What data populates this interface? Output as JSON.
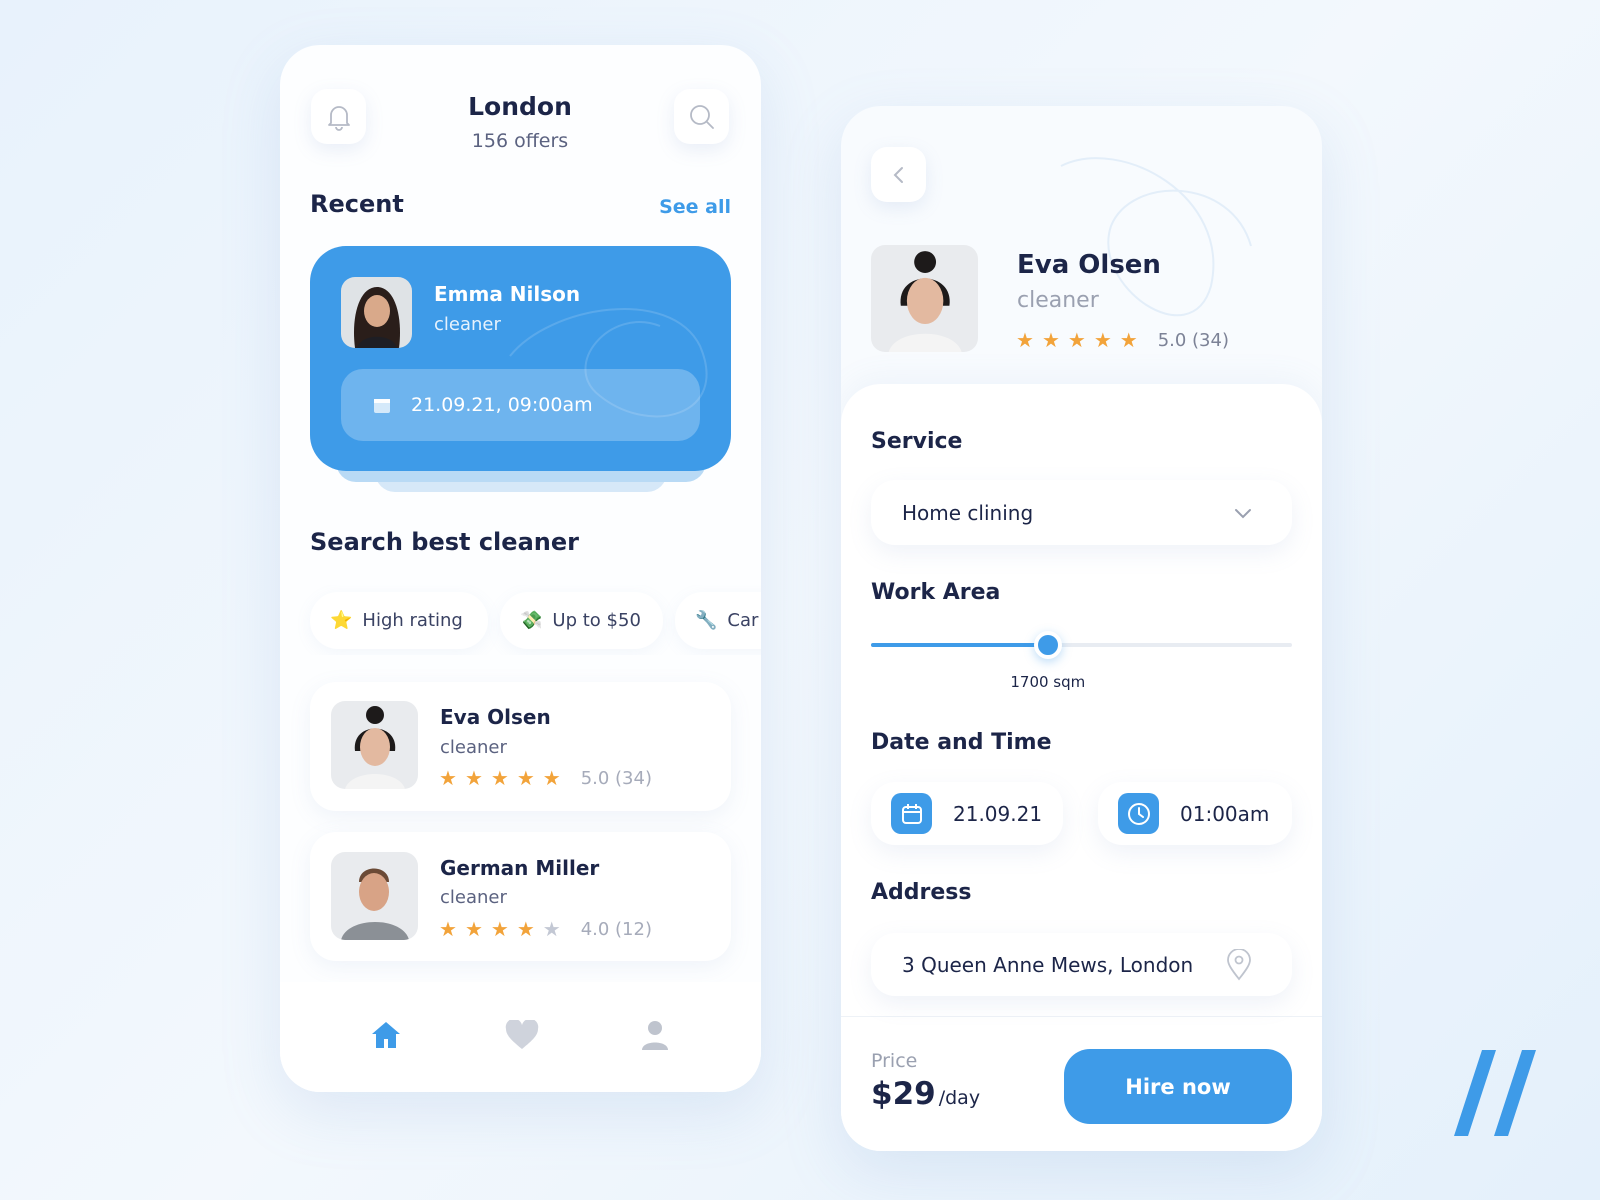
{
  "colors": {
    "accent": "#3e9be8",
    "star": "#f2a33a",
    "text": "#1c2548"
  },
  "left": {
    "header": {
      "city": "London",
      "offers": "156 offers",
      "bell_icon": "bell-icon",
      "search_icon": "search-icon"
    },
    "recent": {
      "title": "Recent",
      "see_all": "See all",
      "card": {
        "name": "Emma Nilson",
        "role": "cleaner",
        "datetime": "21.09.21, 09:00am",
        "icon": "calendar-icon"
      }
    },
    "search": {
      "title": "Search best cleaner",
      "chips": [
        {
          "icon": "⭐",
          "label": "High rating"
        },
        {
          "icon": "💸",
          "label": "Up to $50"
        },
        {
          "icon": "🔧",
          "label": "Car"
        }
      ]
    },
    "cleaners": [
      {
        "name": "Eva Olsen",
        "role": "cleaner",
        "rating": "5.0 (34)",
        "stars": 5
      },
      {
        "name": "German Miller",
        "role": "cleaner",
        "rating": "4.0 (12)",
        "stars": 4
      }
    ],
    "nav": [
      {
        "icon": "home-icon",
        "active": true
      },
      {
        "icon": "heart-icon",
        "active": false
      },
      {
        "icon": "user-icon",
        "active": false
      }
    ]
  },
  "right": {
    "profile": {
      "name": "Eva Olsen",
      "role": "cleaner",
      "rating": "5.0 (34)",
      "stars": 5
    },
    "service": {
      "label": "Service",
      "value": "Home clining"
    },
    "work_area": {
      "label": "Work Area",
      "value": "1700 sqm",
      "fraction": 0.42
    },
    "datetime": {
      "label": "Date and Time",
      "date": "21.09.21",
      "time": "01:00am"
    },
    "address": {
      "label": "Address",
      "value": "3 Queen Anne Mews, London"
    },
    "price": {
      "label": "Price",
      "amount": "$29",
      "unit": "/day"
    },
    "hire_button": "Hire now"
  }
}
